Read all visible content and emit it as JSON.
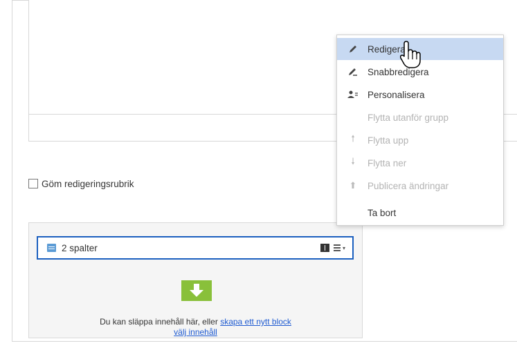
{
  "options": {
    "hide_heading_label": "Göm redigeringsrubrik",
    "hide_heading_checked": false
  },
  "content_area": {
    "block": {
      "title": "2 spalter",
      "icon": "block-layout-icon",
      "tools": [
        "book-icon",
        "list-menu-icon"
      ]
    },
    "drop_zone": {
      "icon": "drop-arrow-icon",
      "text": "Du kan släppa innehåll här, eller",
      "create_link": "skapa ett nytt block",
      "select_link": "välj innehåll"
    }
  },
  "context_menu": {
    "items": [
      {
        "label": "Redigera",
        "icon": "pencil-icon",
        "enabled": true,
        "highlighted": true
      },
      {
        "label": "Snabbredigera",
        "icon": "quick-edit-icon",
        "enabled": true,
        "highlighted": false
      },
      {
        "label": "Personalisera",
        "icon": "people-icon",
        "enabled": true,
        "highlighted": false
      },
      {
        "label": "Flytta utanför grupp",
        "icon": "",
        "enabled": false,
        "highlighted": false
      },
      {
        "label": "Flytta upp",
        "icon": "arrow-up-icon",
        "enabled": false,
        "highlighted": false
      },
      {
        "label": "Flytta ner",
        "icon": "arrow-down-icon",
        "enabled": false,
        "highlighted": false
      },
      {
        "label": "Publicera ändringar",
        "icon": "publish-icon",
        "enabled": false,
        "highlighted": false
      },
      {
        "label": "Ta bort",
        "icon": "",
        "enabled": true,
        "highlighted": false
      }
    ]
  },
  "colors": {
    "accent_blue": "#1b5fbf",
    "menu_highlight": "#c7d9f2",
    "drop_green": "#89c03a",
    "link_blue": "#1f5bd1"
  }
}
